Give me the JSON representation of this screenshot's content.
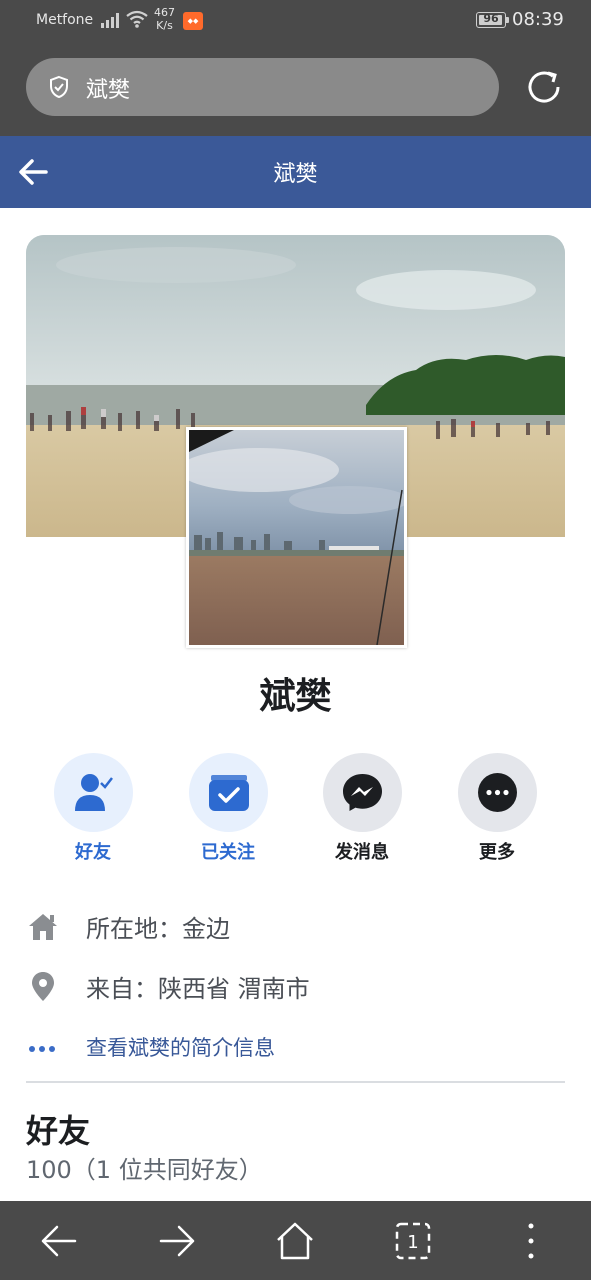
{
  "status_bar": {
    "carrier": "Metfone",
    "net_speed_value": "467",
    "net_speed_unit": "K/s",
    "battery": "96",
    "time": "08:39"
  },
  "browser": {
    "url_text": "斌樊"
  },
  "header": {
    "title": "斌樊"
  },
  "profile": {
    "name": "斌樊"
  },
  "actions": [
    {
      "label": "好友",
      "icon": "friend-check-icon"
    },
    {
      "label": "已关注",
      "icon": "following-check-icon"
    },
    {
      "label": "发消息",
      "icon": "messenger-icon"
    },
    {
      "label": "更多",
      "icon": "more-dots-icon"
    }
  ],
  "info": {
    "location": "所在地：金边",
    "hometown": "来自：陕西省 渭南市",
    "about_link": "查看斌樊的简介信息"
  },
  "friends": {
    "title": "好友",
    "count": "100（1 位共同好友）"
  },
  "colors": {
    "fb_blue": "#3b5998",
    "chrome": "#4a4a4a",
    "action_blue": "#2d6ad0"
  }
}
